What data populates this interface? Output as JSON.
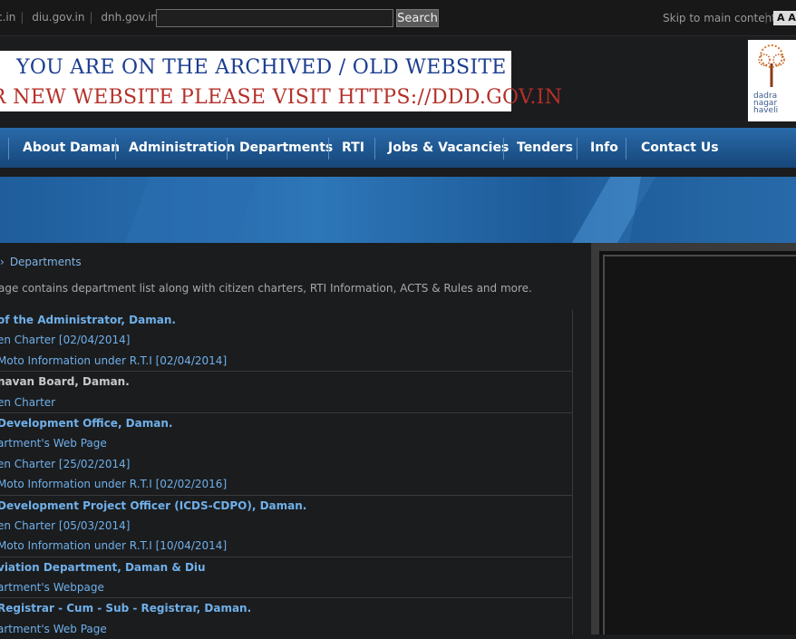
{
  "topbar": {
    "links": [
      "c.in",
      "diu.gov.in",
      "dnh.gov.in"
    ],
    "search_placeholder": "",
    "search_label": "Search",
    "skip_label": "Skip to main content",
    "font_label": "A A"
  },
  "banner": {
    "line1": "YOU ARE ON THE ARCHIVED / OLD WEBSITE",
    "line2": "R NEW WEBSITE PLEASE VISIT HTTPS://DDD.GOV.IN"
  },
  "logo": {
    "text": "dadra nagar haveli"
  },
  "nav": {
    "items": [
      "About Daman",
      "Administration",
      "Departments",
      "RTI",
      "Jobs & Vacancies",
      "Tenders",
      "Info",
      "Contact Us"
    ]
  },
  "breadcrumb": {
    "current": "Departments"
  },
  "intro": "age contains department list along with citizen charters, RTI Information, ACTS & Rules and more.",
  "departments": [
    {
      "text": "of the Administrator, Daman.",
      "kind": "head"
    },
    {
      "text": "en Charter [02/04/2014]",
      "kind": "link"
    },
    {
      "text": "Moto Information under R.T.I [02/04/2014]",
      "kind": "link"
    },
    {
      "text": "navan Board, Daman.",
      "kind": "headplain"
    },
    {
      "text": "en Charter",
      "kind": "link"
    },
    {
      "text": "Development Office, Daman.",
      "kind": "head"
    },
    {
      "text": "artment's Web Page",
      "kind": "link"
    },
    {
      "text": "en Charter [25/02/2014]",
      "kind": "link"
    },
    {
      "text": "Moto Information under R.T.I [02/02/2016]",
      "kind": "link"
    },
    {
      "text": "Development Project Officer (ICDS-CDPO), Daman.",
      "kind": "head"
    },
    {
      "text": "en Charter [05/03/2014]",
      "kind": "link"
    },
    {
      "text": "Moto Information under R.T.I [10/04/2014]",
      "kind": "link"
    },
    {
      "text": "viation Department, Daman & Diu",
      "kind": "head"
    },
    {
      "text": "artment's Webpage",
      "kind": "link"
    },
    {
      "text": "Registrar - Cum - Sub - Registrar, Daman.",
      "kind": "head"
    },
    {
      "text": "artment's Web Page",
      "kind": "link"
    }
  ],
  "colors": {
    "nav_top": "#2a6aaa",
    "nav_bottom": "#16477a",
    "link": "#6fb0ea",
    "background": "#1b1c1e"
  }
}
